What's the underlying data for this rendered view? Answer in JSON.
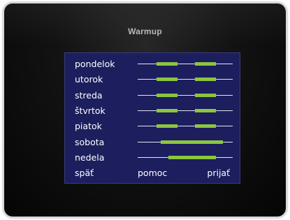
{
  "brand": "Warmup",
  "schedule": [
    {
      "day": "pondelok",
      "segments": [
        [
          0.2,
          0.42
        ],
        [
          0.6,
          0.82
        ]
      ]
    },
    {
      "day": "utorok",
      "segments": [
        [
          0.2,
          0.42
        ],
        [
          0.6,
          0.82
        ]
      ]
    },
    {
      "day": "streda",
      "segments": [
        [
          0.2,
          0.42
        ],
        [
          0.6,
          0.82
        ]
      ]
    },
    {
      "day": "štvrtok",
      "segments": [
        [
          0.2,
          0.42
        ],
        [
          0.6,
          0.82
        ]
      ]
    },
    {
      "day": "piatok",
      "segments": [
        [
          0.2,
          0.42
        ],
        [
          0.6,
          0.82
        ]
      ]
    },
    {
      "day": "sobota",
      "segments": [
        [
          0.24,
          0.9
        ]
      ]
    },
    {
      "day": "nedela",
      "segments": [
        [
          0.32,
          0.82
        ]
      ]
    }
  ],
  "footer": {
    "left": "späť",
    "middle": "pomoc",
    "right": "prijať"
  },
  "colors": {
    "screen": "#1c1e5e",
    "segment": "#8cc63e",
    "track": "#e6e6f0",
    "text": "#ffffff"
  }
}
